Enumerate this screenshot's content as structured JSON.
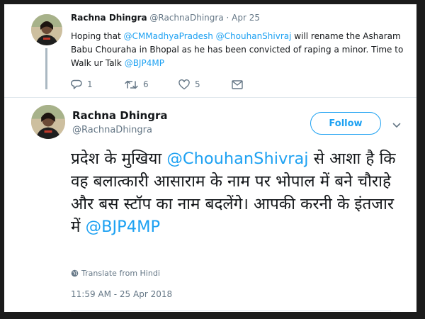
{
  "reply_tweet": {
    "display_name": "Rachna Dhingra",
    "meta": "@RachnaDhingra · Apr 25",
    "text_segments": [
      {
        "text": "Hoping that ",
        "link": false
      },
      {
        "text": "@CMMadhyaPradesh",
        "link": true
      },
      {
        "text": " ",
        "link": false
      },
      {
        "text": "@ChouhanShivraj",
        "link": true
      },
      {
        "text": " will rename the Asharam Babu Chouraha in Bhopal as he has been convicted of raping a minor. Time to Walk ur Talk ",
        "link": false
      },
      {
        "text": "@BJP4MP",
        "link": true
      }
    ],
    "actions": {
      "reply_icon": "reply-icon",
      "reply_count": "1",
      "retweet_icon": "retweet-icon",
      "retweet_count": "6",
      "like_icon": "heart-icon",
      "like_count": "5",
      "dm_icon": "envelope-icon"
    }
  },
  "main_tweet": {
    "display_name": "Rachna Dhingra",
    "handle": "@RachnaDhingra",
    "follow_label": "Follow",
    "text_segments": [
      {
        "text": "प्रदेश के मुखिया ",
        "link": false
      },
      {
        "text": "@ChouhanShivraj",
        "link": true
      },
      {
        "text": " से आशा है कि वह बलात्कारी आसाराम के नाम पर भोपाल में बने चौराहे और बस स्टॉप का नाम बदलेंगे। आपकी करनी के इंतजार में ",
        "link": false
      },
      {
        "text": "@BJP4MP",
        "link": true
      }
    ],
    "translate_label": "Translate from Hindi",
    "timestamp": "11:59 AM - 25 Apr 2018"
  },
  "colors": {
    "accent": "#1da1f2",
    "text": "#14171a",
    "muted": "#657786",
    "frame": "#1b1b1b"
  }
}
